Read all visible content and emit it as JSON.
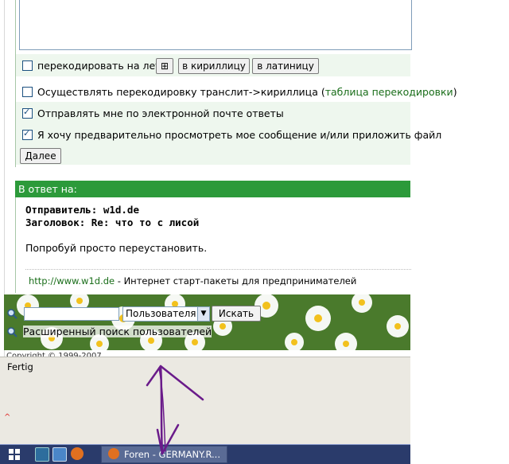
{
  "form": {
    "transliterate_on_the_fly": "перекодировать на лету",
    "btn_cyrillic": "в кириллицу",
    "btn_latin": "в латиницу",
    "translit_label": "Осуществлять перекодировку транслит->кириллица (",
    "translit_link": "таблица перекодировки",
    "translit_close": ")",
    "email_replies": "Отправлять мне по электронной почте ответы",
    "preview_label": "Я хочу предварительно просмотреть мое сообщение и/или приложить файл",
    "next_button": "Далее"
  },
  "reply": {
    "header": "В ответ на:",
    "sender": "Отправитель: w1d.de",
    "subject": "Заголовок: Re: что то с лисой",
    "body": "Попробуй просто переустановить.",
    "signature_link": "http://www.w1d.de",
    "signature_text": " - Интернет старт-пакеты для предпринимателей"
  },
  "search": {
    "select_value": "Пользователя",
    "search_button": "Искать",
    "advanced_link": "Расширенный поиск пользователей",
    "copyright": "Copyright © 1999-2007"
  },
  "statusbar": {
    "text": "Fertig"
  },
  "taskbar": {
    "task_label": "Foren - GERMANY.R..."
  },
  "colors": {
    "accent": "#2c9a3a",
    "annotation": "#6a1b8a"
  }
}
